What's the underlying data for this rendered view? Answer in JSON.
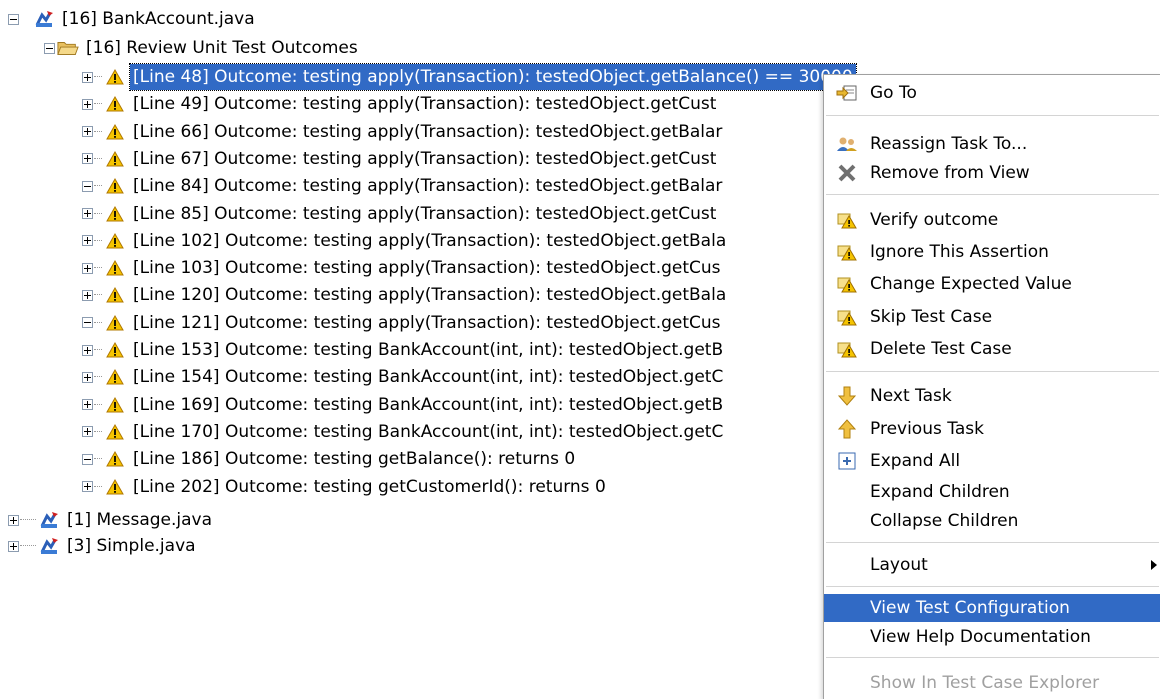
{
  "tree": {
    "root": "[16] BankAccount.java",
    "group": "[16] Review Unit Test Outcomes",
    "items": [
      "[Line 48] Outcome: testing apply(Transaction): testedObject.getBalance() == 30000",
      "[Line 49] Outcome: testing apply(Transaction): testedObject.getCust",
      "[Line 66] Outcome: testing apply(Transaction): testedObject.getBalar",
      "[Line 67] Outcome: testing apply(Transaction): testedObject.getCust",
      "[Line 84] Outcome: testing apply(Transaction): testedObject.getBalar",
      "[Line 85] Outcome: testing apply(Transaction): testedObject.getCust",
      "[Line 102] Outcome: testing apply(Transaction): testedObject.getBala",
      "[Line 103] Outcome: testing apply(Transaction): testedObject.getCus",
      "[Line 120] Outcome: testing apply(Transaction): testedObject.getBala",
      "[Line 121] Outcome: testing apply(Transaction): testedObject.getCus",
      "[Line 153] Outcome: testing BankAccount(int, int): testedObject.getB",
      "[Line 154] Outcome: testing BankAccount(int, int): testedObject.getC",
      "[Line 169] Outcome: testing BankAccount(int, int): testedObject.getB",
      "[Line 170] Outcome: testing BankAccount(int, int): testedObject.getC",
      "[Line 186] Outcome: testing getBalance(): returns 0",
      "[Line 202] Outcome: testing getCustomerId(): returns 0"
    ],
    "files": [
      "[1] Message.java",
      "[3] Simple.java"
    ]
  },
  "menu": {
    "items": [
      {
        "label": "Go To",
        "icon": "goto-icon"
      },
      {
        "label": "Reassign Task To...",
        "icon": "reassign-icon"
      },
      {
        "label": "Remove from View",
        "icon": "remove-icon"
      },
      {
        "label": "Verify outcome",
        "icon": "verify-icon"
      },
      {
        "label": "Ignore This Assertion",
        "icon": "ignore-icon"
      },
      {
        "label": "Change Expected Value",
        "icon": "change-value-icon"
      },
      {
        "label": "Skip Test Case",
        "icon": "skip-icon"
      },
      {
        "label": "Delete Test Case",
        "icon": "delete-icon"
      },
      {
        "label": "Next Task",
        "icon": "arrow-down-icon"
      },
      {
        "label": "Previous Task",
        "icon": "arrow-up-icon"
      },
      {
        "label": "Expand All",
        "icon": "expand-all-icon"
      },
      {
        "label": "Expand Children"
      },
      {
        "label": "Collapse Children"
      },
      {
        "label": "Layout"
      },
      {
        "label": "View Test Configuration"
      },
      {
        "label": "View Help Documentation"
      },
      {
        "label": "Show In Test Case Explorer"
      }
    ]
  },
  "colors": {
    "selection": "#316ac5",
    "warning": "#f5c400",
    "folder": "#e8c060"
  }
}
